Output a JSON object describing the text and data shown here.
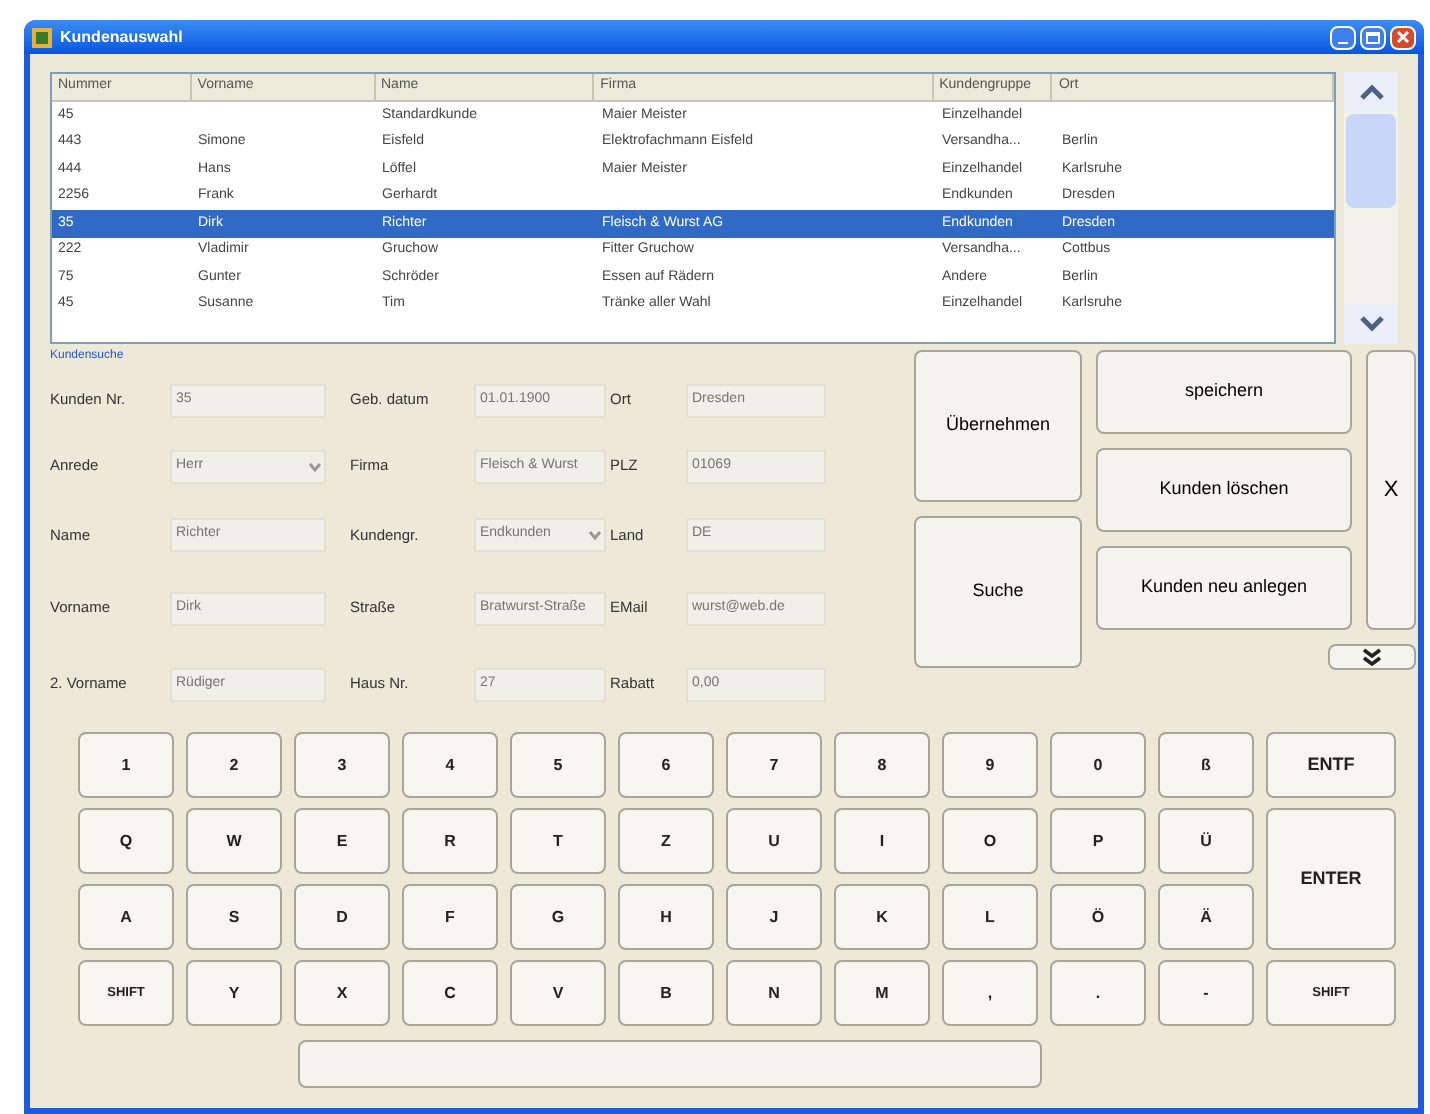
{
  "window": {
    "title": "Kundenauswahl"
  },
  "table": {
    "columns": [
      "Nummer",
      "Vorname",
      "Name",
      "Firma",
      "Kundengruppe",
      "Ort"
    ],
    "rows": [
      {
        "cells": [
          "45",
          "",
          "Standardkunde",
          "Maier Meister",
          "Einzelhandel",
          ""
        ],
        "selected": false
      },
      {
        "cells": [
          "443",
          "Simone",
          "Eisfeld",
          "Elektrofachmann Eisfeld",
          "Versandha...",
          "Berlin"
        ],
        "selected": false
      },
      {
        "cells": [
          "444",
          "Hans",
          "Löffel",
          "Maier Meister",
          "Einzelhandel",
          "Karlsruhe"
        ],
        "selected": false
      },
      {
        "cells": [
          "2256",
          "Frank",
          "Gerhardt",
          "",
          "Endkunden",
          "Dresden"
        ],
        "selected": false
      },
      {
        "cells": [
          "35",
          "Dirk",
          "Richter",
          "Fleisch & Wurst AG",
          "Endkunden",
          "Dresden"
        ],
        "selected": true
      },
      {
        "cells": [
          "222",
          "Vladimir",
          "Gruchow",
          "Fitter Gruchow",
          "Versandha...",
          "Cottbus"
        ],
        "selected": false
      },
      {
        "cells": [
          "75",
          "Gunter",
          "Schröder",
          "Essen auf Rädern",
          "Andere",
          "Berlin"
        ],
        "selected": false
      },
      {
        "cells": [
          "45",
          "Susanne",
          "Tim",
          "Tränke aller Wahl",
          "Einzelhandel",
          "Karlsruhe"
        ],
        "selected": false
      }
    ]
  },
  "form": {
    "title": "Kundensuche",
    "fields": [
      {
        "label": "Kunden Nr.",
        "value": "35",
        "kind": "text"
      },
      {
        "label": "Geb. datum",
        "value": "01.01.1900",
        "kind": "text"
      },
      {
        "label": "Ort",
        "value": "Dresden",
        "kind": "text"
      },
      {
        "label": "Anrede",
        "value": "Herr",
        "kind": "combo"
      },
      {
        "label": "Firma",
        "value": "Fleisch & Wurst",
        "kind": "text"
      },
      {
        "label": "PLZ",
        "value": "01069",
        "kind": "text"
      },
      {
        "label": "Name",
        "value": "Richter",
        "kind": "text"
      },
      {
        "label": "Kundengr.",
        "value": "Endkunden",
        "kind": "combo"
      },
      {
        "label": "Land",
        "value": "DE",
        "kind": "text"
      },
      {
        "label": "Vorname",
        "value": "Dirk",
        "kind": "text"
      },
      {
        "label": "Straße",
        "value": "Bratwurst-Straße",
        "kind": "text"
      },
      {
        "label": "EMail",
        "value": "wurst@web.de",
        "kind": "text"
      },
      {
        "label": "2. Vorname",
        "value": "Rüdiger",
        "kind": "text"
      },
      {
        "label": "Haus Nr.",
        "value": "27",
        "kind": "text"
      },
      {
        "label": "Rabatt",
        "value": "0,00",
        "kind": "text"
      }
    ]
  },
  "actions": {
    "accept": "Übernehmen",
    "search": "Suche",
    "save": "speichern",
    "delete": "Kunden löschen",
    "create": "Kunden neu anlegen",
    "close": "X"
  },
  "keyboard": {
    "keys": [
      {
        "label": "1",
        "kind": "key"
      },
      {
        "label": "2",
        "kind": "key"
      },
      {
        "label": "3",
        "kind": "key"
      },
      {
        "label": "4",
        "kind": "key"
      },
      {
        "label": "5",
        "kind": "key"
      },
      {
        "label": "6",
        "kind": "key"
      },
      {
        "label": "7",
        "kind": "key"
      },
      {
        "label": "8",
        "kind": "key"
      },
      {
        "label": "9",
        "kind": "key"
      },
      {
        "label": "0",
        "kind": "key"
      },
      {
        "label": "ß",
        "kind": "key"
      },
      {
        "label": "ENTF",
        "kind": "wide"
      },
      {
        "label": "Q",
        "kind": "key"
      },
      {
        "label": "W",
        "kind": "key"
      },
      {
        "label": "E",
        "kind": "key"
      },
      {
        "label": "R",
        "kind": "key"
      },
      {
        "label": "T",
        "kind": "key"
      },
      {
        "label": "Z",
        "kind": "key"
      },
      {
        "label": "U",
        "kind": "key"
      },
      {
        "label": "I",
        "kind": "key"
      },
      {
        "label": "O",
        "kind": "key"
      },
      {
        "label": "P",
        "kind": "key"
      },
      {
        "label": "Ü",
        "kind": "key"
      },
      {
        "label": "ENTER",
        "kind": "tall"
      },
      {
        "label": "A",
        "kind": "key"
      },
      {
        "label": "S",
        "kind": "key"
      },
      {
        "label": "D",
        "kind": "key"
      },
      {
        "label": "F",
        "kind": "key"
      },
      {
        "label": "G",
        "kind": "key"
      },
      {
        "label": "H",
        "kind": "key"
      },
      {
        "label": "J",
        "kind": "key"
      },
      {
        "label": "K",
        "kind": "key"
      },
      {
        "label": "L",
        "kind": "key"
      },
      {
        "label": "Ö",
        "kind": "key"
      },
      {
        "label": "Ä",
        "kind": "key"
      },
      {
        "label": "SHIFT",
        "kind": "small"
      },
      {
        "label": "Y",
        "kind": "key"
      },
      {
        "label": "X",
        "kind": "key"
      },
      {
        "label": "C",
        "kind": "key"
      },
      {
        "label": "V",
        "kind": "key"
      },
      {
        "label": "B",
        "kind": "key"
      },
      {
        "label": "N",
        "kind": "key"
      },
      {
        "label": "M",
        "kind": "key"
      },
      {
        "label": ",",
        "kind": "key"
      },
      {
        "label": ".",
        "kind": "key"
      },
      {
        "label": "-",
        "kind": "key"
      },
      {
        "label": "SHIFT",
        "kind": "small"
      }
    ]
  }
}
